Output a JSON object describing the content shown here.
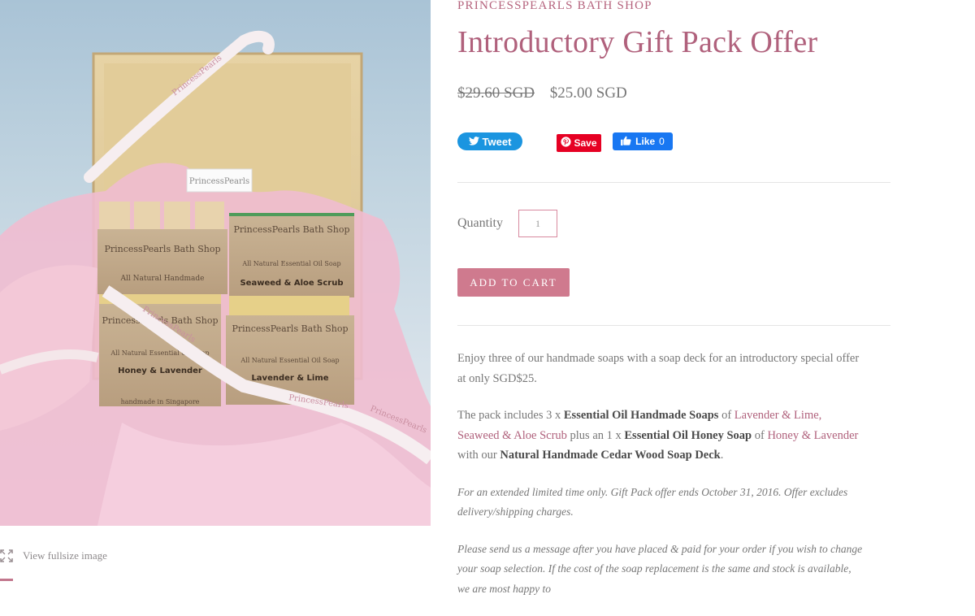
{
  "image": {
    "alt": "Introductory gift pack box with soaps",
    "view_fullsize_label": "View fullsize image",
    "box_tag": "PrincessPearls",
    "ribbon_text": "PrincessPearls",
    "soaps": [
      {
        "brand": "PrincessPearls Bath Shop",
        "line1": "All Natural Handmade",
        "line2": ""
      },
      {
        "brand": "PrincessPearls Bath Shop",
        "line1": "All Natural Essential Oil Soap",
        "line2": "Seaweed & Aloe Scrub"
      },
      {
        "brand": "PrincessPearls Bath Shop",
        "line1": "All Natural Essential Oil Soap",
        "line2": "Honey & Lavender"
      },
      {
        "brand": "PrincessPearls Bath Shop",
        "line1": "All Natural Essential Oil Soap",
        "line2": "Lavender & Lime"
      }
    ],
    "soap_footer": "handmade in Singapore"
  },
  "product": {
    "brand": "PRINCESSPEARLS BATH SHOP",
    "title": "Introductory Gift Pack Offer",
    "price_original": "$29.60 SGD",
    "price_sale": "$25.00 SGD"
  },
  "social": {
    "tweet_label": "Tweet",
    "save_label": "Save",
    "like_label": "Like",
    "like_count": "0"
  },
  "purchase": {
    "quantity_label": "Quantity",
    "quantity_value": "1",
    "add_to_cart_label": "ADD TO CART"
  },
  "description": {
    "p1": "Enjoy three of our handmade soaps with a soap deck for an introductory special offer at only SGD$25.",
    "p2_1": "The pack includes 3 x ",
    "p2_b1": "Essential Oil Handmade Soaps",
    "p2_2": " of ",
    "p2_l1": "Lavender & Lime,",
    "p2_sp": " ",
    "p2_l2": "Seaweed & Aloe Scrub",
    "p2_3": " plus an 1 x ",
    "p2_b2": "Essential Oil Honey Soap",
    "p2_4": " of ",
    "p2_l3": "Honey & Lavender",
    "p2_5": " with our ",
    "p2_b3": "Natural Handmade Cedar Wood Soap Deck",
    "p2_6": ".",
    "p3": "For an extended limited time only. Gift Pack offer ends October 31, 2016. Offer excludes delivery/shipping charges.",
    "p4": "Please send us a message after you have placed & paid for your order if you wish to change your soap selection. If the cost of the soap replacement is the same and stock is available, we are most happy to"
  },
  "colors": {
    "accent": "#b0617c",
    "button": "#cf7a8e",
    "twitter": "#1b95e0",
    "pinterest": "#e60023",
    "facebook": "#1877f2"
  }
}
